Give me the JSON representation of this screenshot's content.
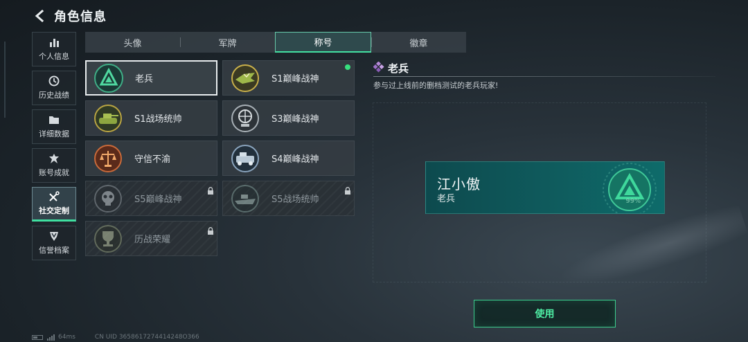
{
  "header": {
    "title": "角色信息"
  },
  "sidebar": {
    "items": [
      {
        "label": "个人信息",
        "icon": "bar-chart-icon"
      },
      {
        "label": "历史战绩",
        "icon": "clock-icon"
      },
      {
        "label": "详细数据",
        "icon": "folder-icon"
      },
      {
        "label": "账号成就",
        "icon": "achievement-icon"
      },
      {
        "label": "社交定制",
        "icon": "tools-icon",
        "active": true
      },
      {
        "label": "信誉档案",
        "icon": "shield-icon"
      }
    ]
  },
  "tabs": [
    {
      "label": "头像"
    },
    {
      "label": "军牌"
    },
    {
      "label": "称号",
      "active": true
    },
    {
      "label": "徽章"
    }
  ],
  "titles": [
    {
      "name": "老兵",
      "icon": "veteran-emblem-icon",
      "selected": true
    },
    {
      "name": "S1巅峰战神",
      "icon": "crocodile-emblem-icon",
      "equipped": true
    },
    {
      "name": "S1战场统帅",
      "icon": "tank-emblem-icon"
    },
    {
      "name": "S3巅峰战神",
      "icon": "globe-emblem-icon"
    },
    {
      "name": "守信不渝",
      "icon": "scales-emblem-icon"
    },
    {
      "name": "S4巅峰战神",
      "icon": "vehicle-emblem-icon"
    },
    {
      "name": "S5巅峰战神",
      "icon": "skull-emblem-icon",
      "locked": true
    },
    {
      "name": "S5战场统帅",
      "icon": "ship-emblem-icon",
      "locked": true
    },
    {
      "name": "历战荣耀",
      "icon": "trophy-emblem-icon",
      "locked": true
    }
  ],
  "detail": {
    "title": "老兵",
    "description": "参与过上线前的删档测试的老兵玩家!"
  },
  "preview": {
    "player_name": "江小傲",
    "title": "老兵",
    "percent": "99%"
  },
  "actions": {
    "use_label": "使用"
  },
  "footer": {
    "ping": "64ms",
    "uid": "CN UID 3658617274414248O366"
  },
  "colors": {
    "accent": "#3fe0a0",
    "preview_bg": "#0f5a5c",
    "equipped_dot": "#37e07e"
  }
}
